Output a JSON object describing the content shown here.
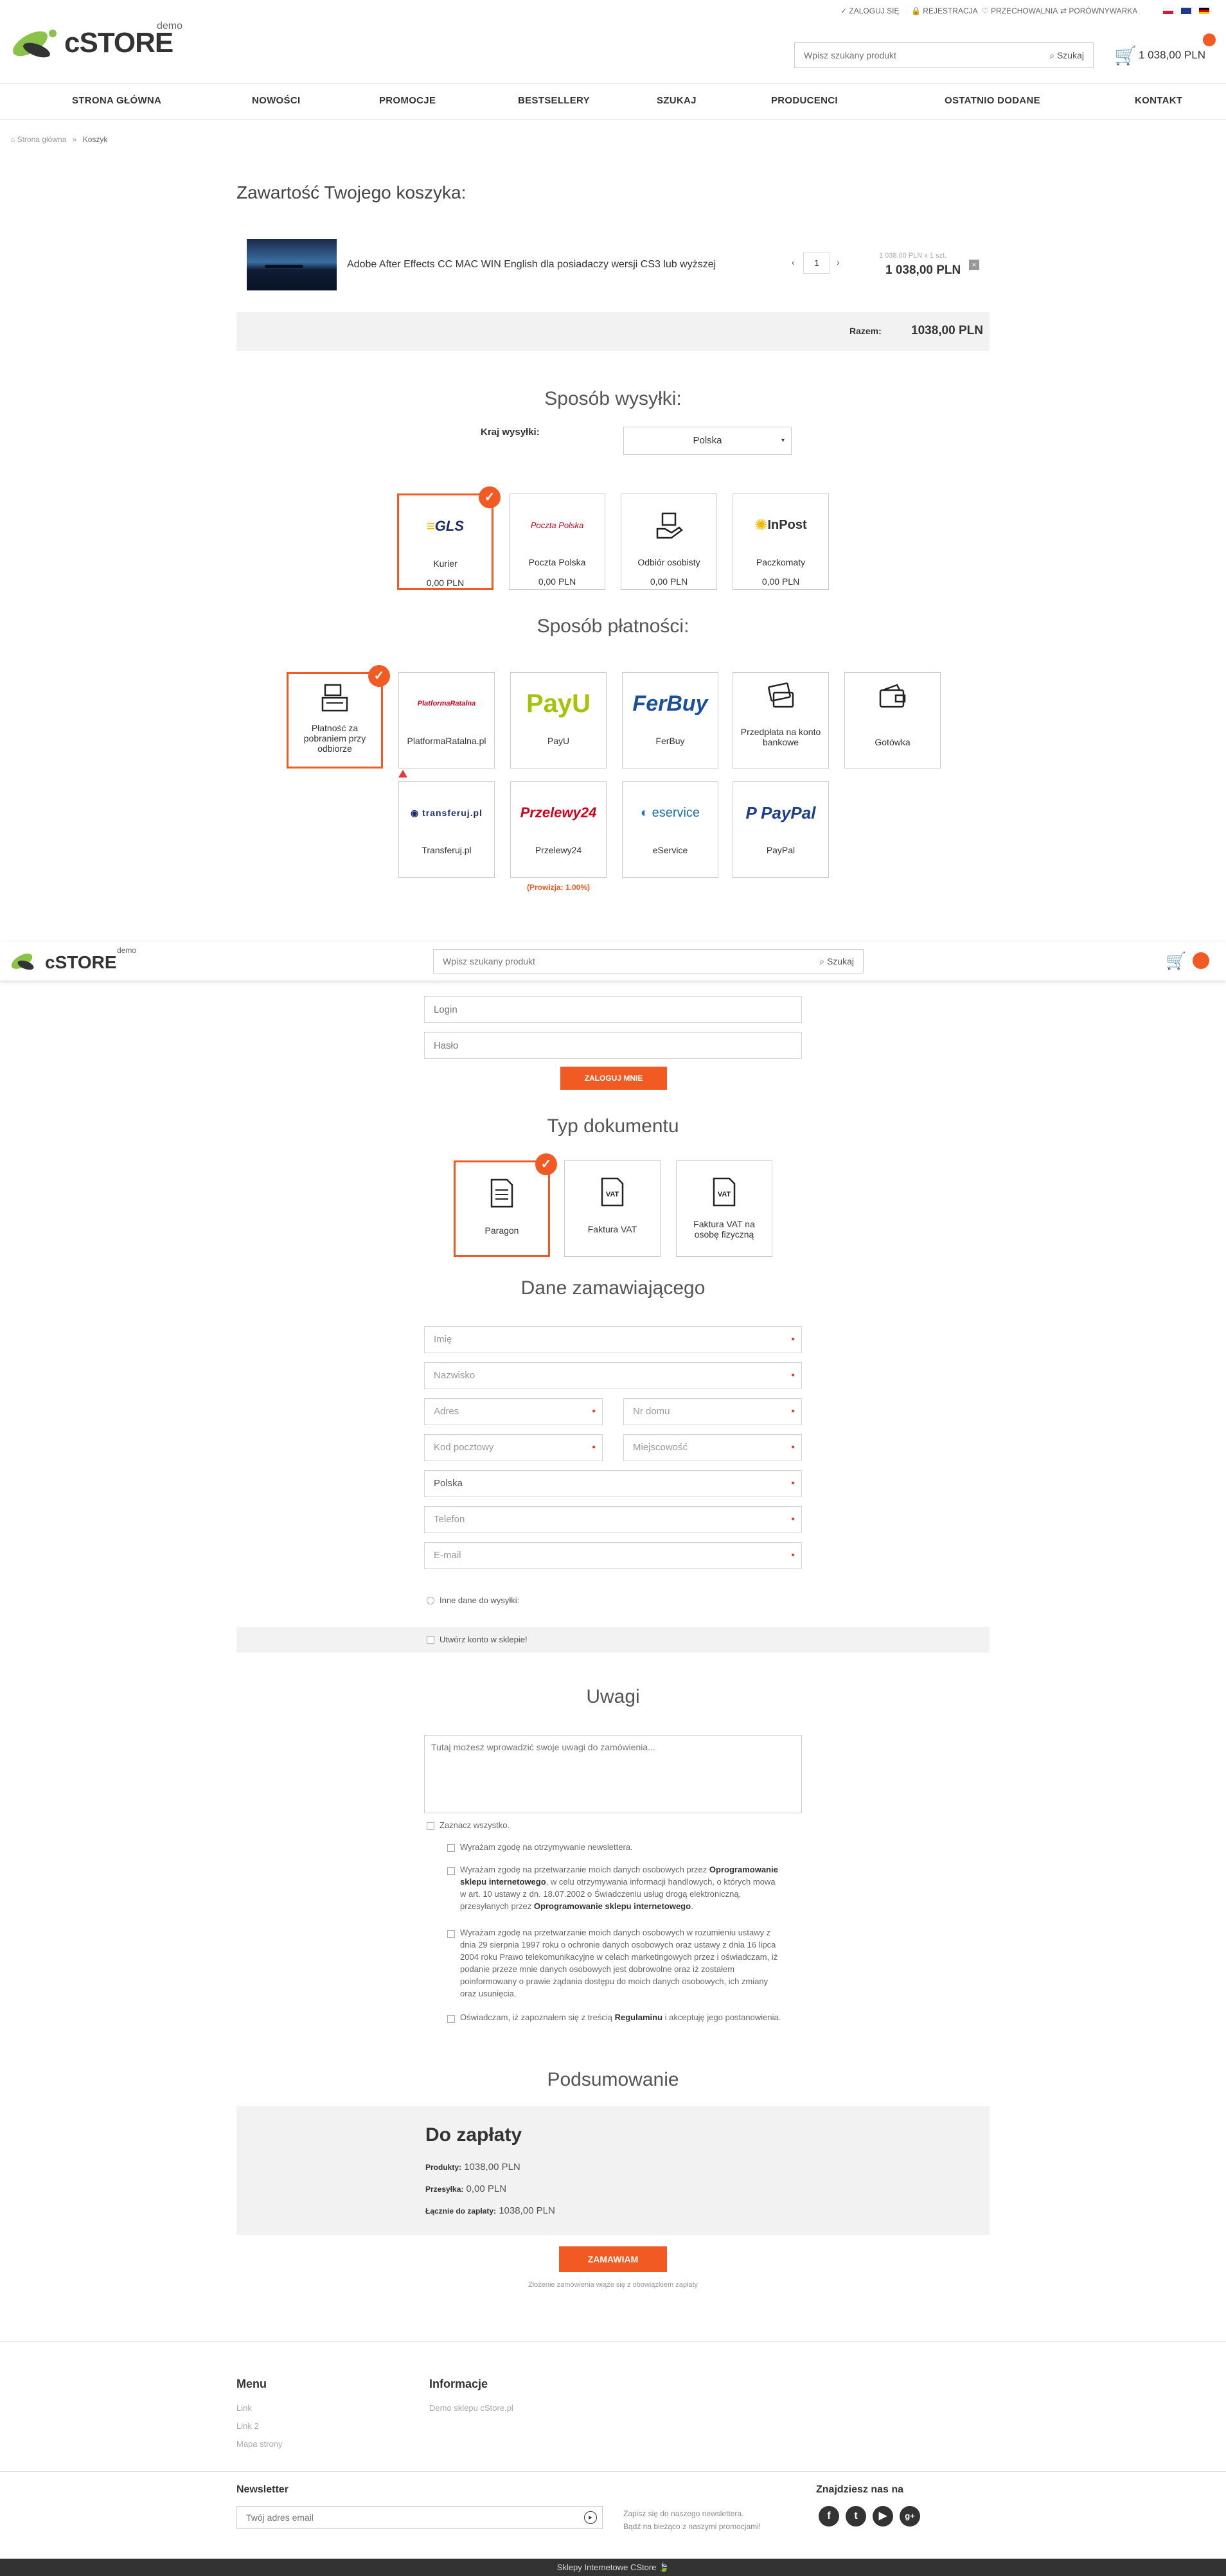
{
  "topbar": {
    "login": "ZALOGUJ SIĘ",
    "register": "REJESTRACJA",
    "wishlist": "PRZECHOWALNIA",
    "compare": "PORÓWNYWARKA"
  },
  "header": {
    "logo_text": "cSTORE",
    "logo_demo": "demo",
    "search_placeholder": "Wpisz szukany produkt",
    "search_button": "Szukaj",
    "cart_total": "1 038,00 PLN"
  },
  "nav": [
    "STRONA GŁÓWNA",
    "NOWOŚCI",
    "PROMOCJE",
    "BESTSELLERY",
    "SZUKAJ",
    "PRODUCENCI",
    "OSTATNIO DODANE",
    "KONTAKT"
  ],
  "breadcrumb": {
    "home": "Strona główna",
    "sep": "»",
    "current": "Koszyk"
  },
  "cart": {
    "title": "Zawartość Twojego koszyka:",
    "item_name": "Adobe After Effects CC MAC WIN English dla posiadaczy wersji CS3 lub wyższej",
    "qty": "1",
    "unit_price": "1 038,00 PLN x 1 szt.",
    "item_total": "1 038,00 PLN",
    "sum_label": "Razem:",
    "sum_value": "1038,00 PLN"
  },
  "shipping": {
    "title": "Sposób wysyłki:",
    "country_label": "Kraj wysyłki:",
    "country_value": "Polska",
    "options": [
      {
        "name": "Kurier",
        "price": "0,00 PLN",
        "logo": "GLS"
      },
      {
        "name": "Poczta Polska",
        "price": "0,00 PLN",
        "logo": "Poczta Polska"
      },
      {
        "name": "Odbiór osobisty",
        "price": "0,00 PLN",
        "logo": "hand-box-icon"
      },
      {
        "name": "Paczkomaty",
        "price": "0,00 PLN",
        "logo": "InPost"
      }
    ]
  },
  "payment": {
    "title": "Sposób płatności:",
    "options": [
      {
        "name": "Płatność za pobraniem przy odbiorze"
      },
      {
        "name": "PlatformaRatalna.pl",
        "logo": "PlatformaRatalna"
      },
      {
        "name": "PayU",
        "logo": "PayU"
      },
      {
        "name": "FerBuy",
        "logo": "FerBuy"
      },
      {
        "name": "Przedpłata na konto bankowe"
      },
      {
        "name": "Gotówka"
      },
      {
        "name": "Transferuj.pl",
        "logo": "transferuj.pl"
      },
      {
        "name": "Przelewy24",
        "logo": "Przelewy24"
      },
      {
        "name": "eService",
        "logo": "eservice"
      },
      {
        "name": "PayPal",
        "logo": "PayPal"
      }
    ],
    "commission": "(Prowizja: 1.00%)"
  },
  "login": {
    "login_placeholder": "Login",
    "password_placeholder": "Hasło",
    "button": "ZALOGUJ MNIE"
  },
  "document": {
    "title": "Typ dokumentu",
    "options": [
      {
        "name": "Paragon"
      },
      {
        "name": "Faktura VAT"
      },
      {
        "name": "Faktura VAT na osobę fizyczną"
      }
    ]
  },
  "customer": {
    "title": "Dane zamawiającego",
    "first_name": "Imię",
    "last_name": "Nazwisko",
    "address": "Adres",
    "house_no": "Nr domu",
    "postcode": "Kod pocztowy",
    "city": "Miejscowość",
    "country": "Polska",
    "phone": "Telefon",
    "email": "E-mail",
    "other_shipping": "Inne dane do wysyłki:",
    "create_account": "Utwórz konto w sklepie!"
  },
  "notes": {
    "title": "Uwagi",
    "placeholder": "Tutaj możesz wprowadzić swoje uwagi do zamówienia..."
  },
  "consents": {
    "select_all": "Zaznacz wszystko.",
    "c1": "Wyrażam zgodę na otrzymywanie newslettera.",
    "c2_a": "Wyrażam zgodę na przetwarzanie moich danych osobowych przez",
    "c2_b": "Oprogramowanie sklepu internetowego",
    "c2_c": ", w celu otrzymywania informacji handlowych, o których mowa w art. 10 ustawy z dn. 18.07.2002 o Świadczeniu usług drogą elektroniczną, przesyłanych przez",
    "c2_d": "Oprogramowanie sklepu internetowego",
    "c3": "Wyrażam zgodę na przetwarzanie moich danych osobowych w rozumieniu ustawy z dnia 29 sierpnia 1997 roku o ochronie danych osobowych oraz ustawy z dnia 16 lipca 2004 roku Prawo telekomunikacyjne w celach marketingowych przez i oświadczam, iż podanie przeze mnie danych osobowych jest dobrowolne oraz iż zostałem poinformowany o prawie żądania dostępu do moich danych osobowych, ich zmiany oraz usunięcia.",
    "c4_a": "Oświadczam, iż zapoznałem się z treścią",
    "c4_b": "Regulaminu",
    "c4_c": "i akceptuję jego postanowienia."
  },
  "summary": {
    "title": "Podsumowanie",
    "heading": "Do zapłaty",
    "products_label": "Produkty:",
    "products_value": "1038,00 PLN",
    "shipping_label": "Przesyłka:",
    "shipping_value": "0,00 PLN",
    "total_label": "Łącznie do zapłaty:",
    "total_value": "1038,00 PLN",
    "order_button": "ZAMAWIAM",
    "note": "Złożenie zamówienia wiąże się z obowiązkiem zapłaty"
  },
  "footer": {
    "menu_title": "Menu",
    "menu_links": [
      "Link",
      "Link 2",
      "Mapa strony"
    ],
    "info_title": "Informacje",
    "info_links": [
      "Demo sklepu cStore.pl"
    ],
    "newsletter_title": "Newsletter",
    "newsletter_placeholder": "Twój adres email",
    "newsletter_text_1": "Zapisz się do naszego newslettera.",
    "newsletter_text_2": "Bądź na bieżąco z naszymi promocjami!",
    "social_title": "Znajdziesz nas na",
    "social": [
      "f",
      "t",
      "▶",
      "g+"
    ],
    "bottom": "Sklepy Internetowe CStore"
  },
  "colors": {
    "accent": "#f15a22",
    "logo_green": "#8bc34a"
  }
}
